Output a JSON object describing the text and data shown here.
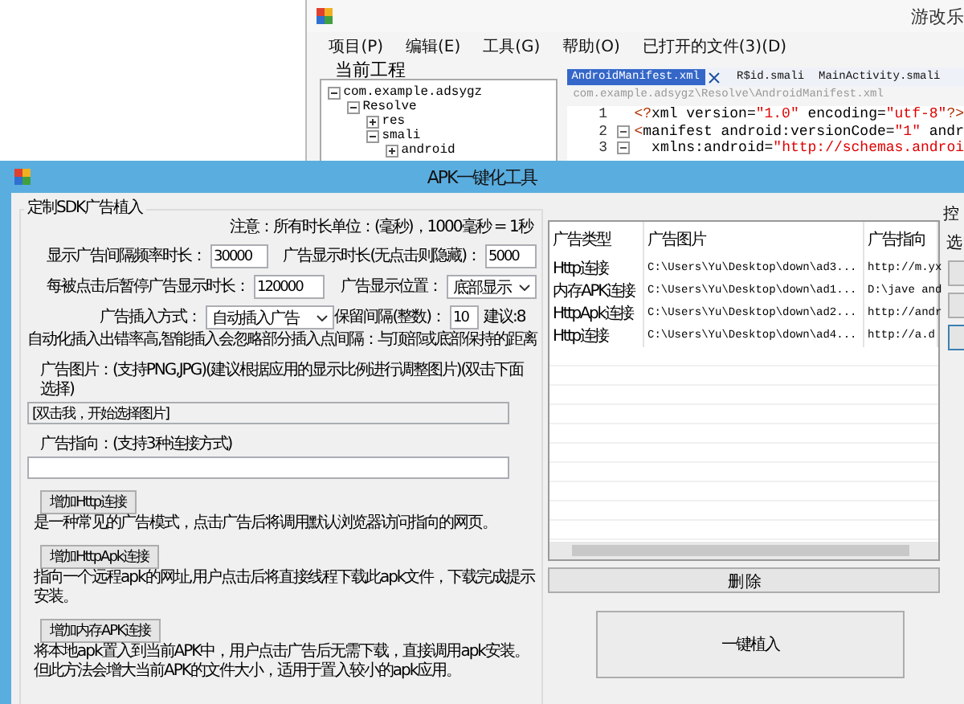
{
  "background_window": {
    "title": "游改乐",
    "menu": [
      "项目(P)",
      "编辑(E)",
      "工具(G)",
      "帮助(O)",
      "已打开的文件(3)(D)"
    ],
    "project_label": "当前工程",
    "tree": [
      {
        "label": "com.example.adsygz",
        "expanded": true,
        "children": [
          {
            "label": "Resolve",
            "expanded": true,
            "children": [
              {
                "label": "res",
                "expanded": false
              },
              {
                "label": "smali",
                "expanded": true,
                "children": [
                  {
                    "label": "android",
                    "expanded": false
                  }
                ]
              }
            ]
          }
        ]
      }
    ],
    "tabs": [
      {
        "label": "AndroidManifest.xml",
        "selected": true
      },
      {
        "label": "R$id.smali",
        "selected": false
      },
      {
        "label": "MainActivity.smali",
        "selected": false
      }
    ],
    "path": "com.example.adsygz\\Resolve\\AndroidManifest.xml",
    "code_lines": [
      {
        "number": "1",
        "foldable": false,
        "tokens": [
          {
            "kind": "tag",
            "text": "<?"
          },
          {
            "kind": "plain",
            "text": "xml version="
          },
          {
            "kind": "str",
            "text": "\"1.0\""
          },
          {
            "kind": "plain",
            "text": " encoding="
          },
          {
            "kind": "str",
            "text": "\"utf-8\""
          },
          {
            "kind": "tag",
            "text": "?>"
          }
        ]
      },
      {
        "number": "2",
        "foldable": true,
        "tokens": [
          {
            "kind": "tag",
            "text": "<"
          },
          {
            "kind": "plain",
            "text": "manifest android:versionCode="
          },
          {
            "kind": "str",
            "text": "\"1\""
          },
          {
            "kind": "plain",
            "text": " andr"
          }
        ]
      },
      {
        "number": "3",
        "foldable": true,
        "tokens": [
          {
            "kind": "plain",
            "text": "  xmlns:android="
          },
          {
            "kind": "str",
            "text": "\"http://schemas.androi"
          }
        ]
      }
    ]
  },
  "dialog": {
    "title": "APK一键化工具",
    "group_title": "定制SDK广告植入",
    "note": "注意：所有时长单位：(毫秒)，1000毫秒 = 1秒",
    "interval": {
      "label": "显示广告间隔频率时长：",
      "value": "30000"
    },
    "duration": {
      "label": "广告显示时长(无点击则隐藏)：",
      "value": "5000"
    },
    "pause": {
      "label": "每被点击后暂停广告显示时长：",
      "value": "120000"
    },
    "position": {
      "label": "广告显示位置：",
      "value": "底部显示"
    },
    "insert_mode": {
      "label": "广告插入方式：",
      "value": "自动插入广告",
      "hint": "自动化插入出错率高,智能插入会忽略部分插入点"
    },
    "margin": {
      "label": "保留间隔(整数)：",
      "value": "10",
      "suggestion": "建议:8",
      "hint": "间隔：与顶部或底部保持的距离"
    },
    "image": {
      "label": "广告图片：(支持PNG,JPG)(建议根据应用的显示比例进行调整图片)(双击下面选择)",
      "value": "[双击我，开始选择图片]"
    },
    "target": {
      "label": "广告指向：(支持3种连接方式)"
    },
    "link_buttons": [
      {
        "label": "增加Http连接",
        "description": "是一种常见的广告模式，点击广告后将调用默认浏览器访问指向的网页。"
      },
      {
        "label": "增加HttpApk连接",
        "description": "指向一个远程apk的网址,用户点击后将直接线程下载此apk文件，下载完成提示安装。"
      },
      {
        "label": "增加内存APK连接",
        "description": "将本地apk置入到当前APK中，用户点击广告后无需下载，直接调用apk安装。但此方法会增大当前APK的文件大小，适用于置入较小的apk应用。"
      }
    ],
    "ad_table": {
      "columns": [
        "广告类型",
        "广告图片",
        "广告指向"
      ],
      "rows": [
        [
          "Http连接",
          "C:\\Users\\Yu\\Desktop\\down\\ad3...",
          "http://m.yx"
        ],
        [
          "内存APK连接",
          "C:\\Users\\Yu\\Desktop\\down\\ad1...",
          "D:\\jave and"
        ],
        [
          "HttpApk连接",
          "C:\\Users\\Yu\\Desktop\\down\\ad2...",
          "http://andr"
        ],
        [
          "Http连接",
          "C:\\Users\\Yu\\Desktop\\down\\ad4...",
          "http://a.d"
        ]
      ]
    },
    "delete_button": "删 除",
    "inject_button": "一键植入",
    "side": {
      "group_label": "控",
      "label": "选"
    }
  }
}
